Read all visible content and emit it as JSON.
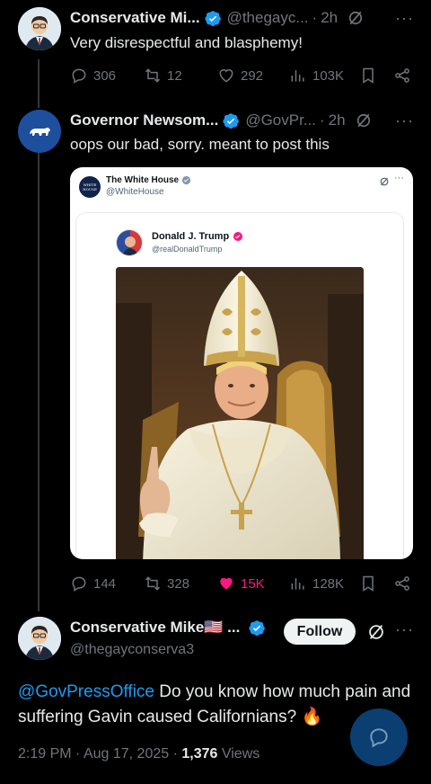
{
  "tweet1": {
    "name": "Conservative Mi...",
    "handle": "@thegayc...",
    "time": "2h",
    "text": "Very disrespectful and blasphemy!",
    "replies": "306",
    "retweets": "12",
    "likes": "292",
    "views": "103K"
  },
  "tweet2": {
    "name": "Governor Newsom...",
    "handle": "@GovPr...",
    "time": "2h",
    "text": "oops our bad, sorry. meant to post this",
    "replies": "144",
    "retweets": "328",
    "likes": "15K",
    "views": "128K",
    "embed": {
      "account_name": "The White House",
      "account_handle": "@WhiteHouse",
      "logo_text": "WHITE HOUSE",
      "inner_name": "Donald J. Trump",
      "inner_handle": "@realDonaldTrump"
    }
  },
  "main_tweet": {
    "name": "Conservative Mike🇺🇸 ...",
    "handle": "@thegayconserva3",
    "follow_label": "Follow",
    "mention": "@GovPressOffice",
    "text_rest": " Do you know how much pain and suffering Gavin caused Californians?",
    "emoji": "🔥",
    "time": "2:19 PM",
    "date": "Aug 17, 2025",
    "views_count": "1,376",
    "views_label": "Views"
  },
  "colors": {
    "background": "#000000",
    "text": "#e7e9ea",
    "muted": "#71767b",
    "accent": "#1d9bf0",
    "like": "#f91880"
  }
}
